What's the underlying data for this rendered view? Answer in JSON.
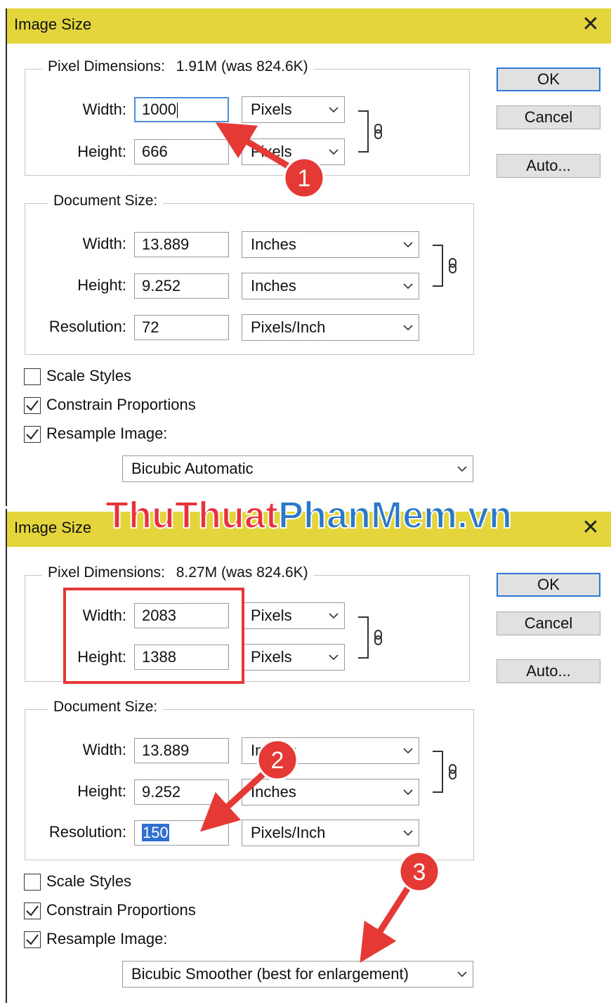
{
  "dialogs": [
    {
      "title": "Image Size",
      "pixel_dimensions_label": "Pixel Dimensions:",
      "pixel_dimensions_value": "1.91M (was 824.6K)",
      "pixel_width_label": "Width:",
      "pixel_width_value": "1000",
      "pixel_width_unit": "Pixels",
      "pixel_height_label": "Height:",
      "pixel_height_value": "666",
      "pixel_height_unit": "Pixels",
      "document_size_label": "Document Size:",
      "doc_width_label": "Width:",
      "doc_width_value": "13.889",
      "doc_width_unit": "Inches",
      "doc_height_label": "Height:",
      "doc_height_value": "9.252",
      "doc_height_unit": "Inches",
      "resolution_label": "Resolution:",
      "resolution_value": "72",
      "resolution_unit": "Pixels/Inch",
      "scale_styles_label": "Scale Styles",
      "scale_styles_checked": false,
      "constrain_label": "Constrain Proportions",
      "constrain_checked": true,
      "resample_label": "Resample Image:",
      "resample_checked": true,
      "resample_method": "Bicubic Automatic",
      "ok_label": "OK",
      "cancel_label": "Cancel",
      "auto_label": "Auto..."
    },
    {
      "title": "Image Size",
      "pixel_dimensions_label": "Pixel Dimensions:",
      "pixel_dimensions_value": "8.27M (was 824.6K)",
      "pixel_width_label": "Width:",
      "pixel_width_value": "2083",
      "pixel_width_unit": "Pixels",
      "pixel_height_label": "Height:",
      "pixel_height_value": "1388",
      "pixel_height_unit": "Pixels",
      "document_size_label": "Document Size:",
      "doc_width_label": "Width:",
      "doc_width_value": "13.889",
      "doc_width_unit": "Inches",
      "doc_height_label": "Height:",
      "doc_height_value": "9.252",
      "doc_height_unit": "Inches",
      "resolution_label": "Resolution:",
      "resolution_value": "150",
      "resolution_unit": "Pixels/Inch",
      "scale_styles_label": "Scale Styles",
      "scale_styles_checked": false,
      "constrain_label": "Constrain Proportions",
      "constrain_checked": true,
      "resample_label": "Resample Image:",
      "resample_checked": true,
      "resample_method": "Bicubic Smoother (best for enlargement)",
      "ok_label": "OK",
      "cancel_label": "Cancel",
      "auto_label": "Auto..."
    }
  ],
  "annotations": {
    "badge_1": "1",
    "badge_2": "2",
    "badge_3": "3",
    "badge_color": "#e53935",
    "arrow_color": "#e53935",
    "highlight_box_color": "#e53935"
  },
  "watermark": {
    "part1": "ThuThuat",
    "part2": "PhanMem",
    "part3": ".vn",
    "color_part1": "#e8313c",
    "color_part2": "#2b78c9"
  },
  "icons": {
    "close": "close-icon",
    "chain": "chain-link-icon",
    "dropdown": "chevron-down-icon",
    "checkmark": "checkmark-icon"
  }
}
